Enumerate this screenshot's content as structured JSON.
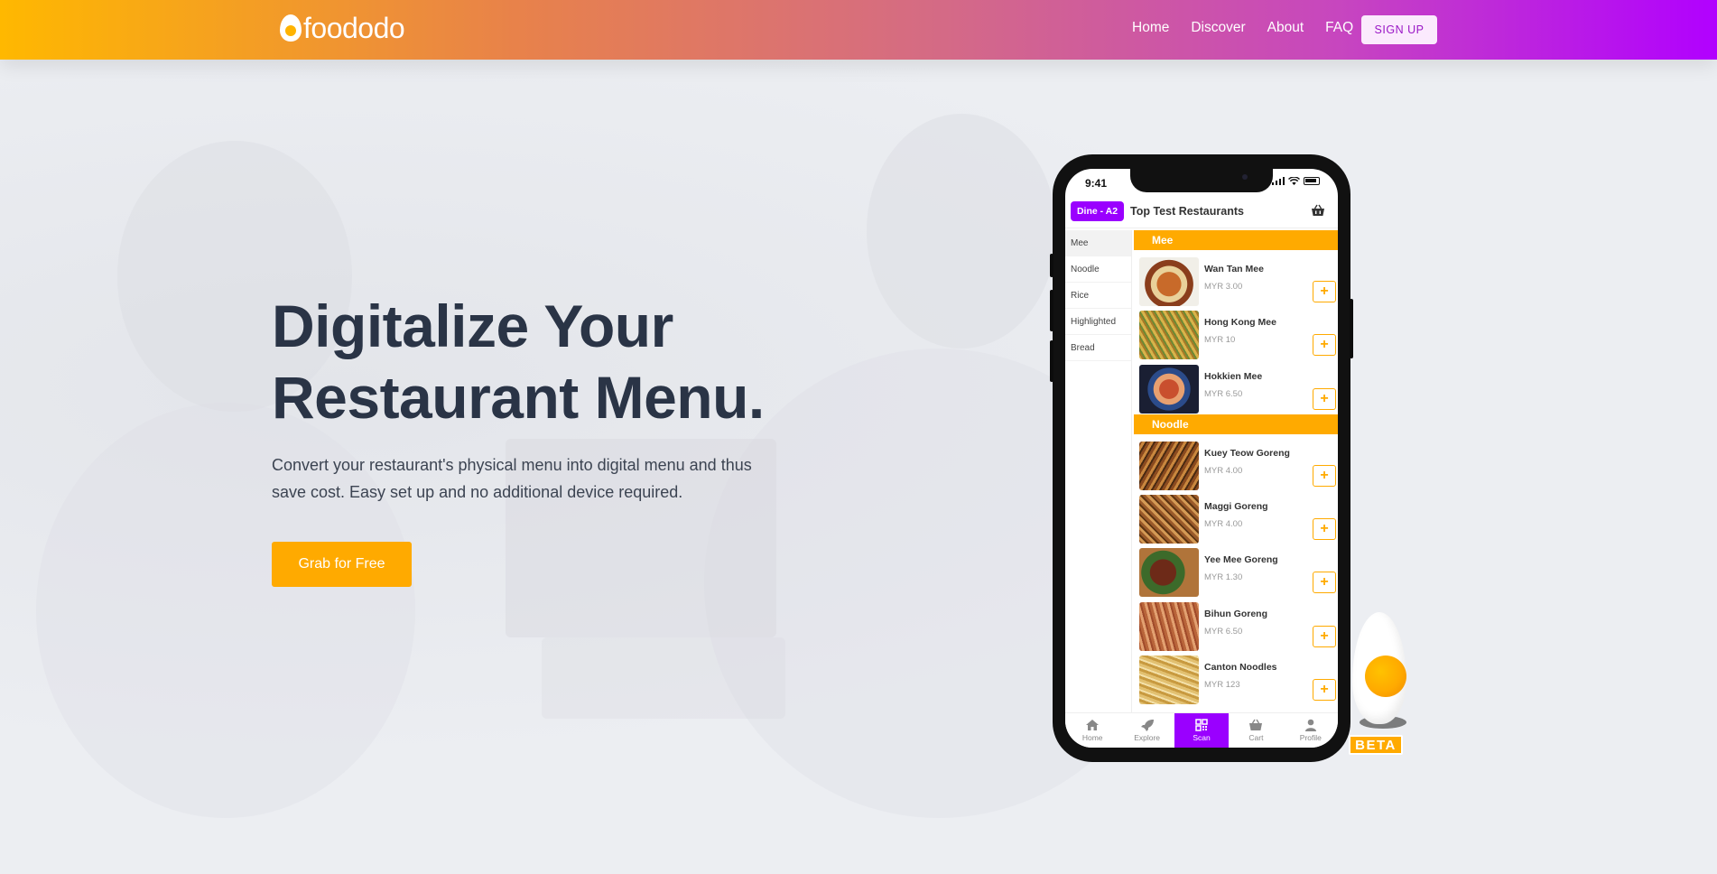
{
  "header": {
    "logo_text": "foododo",
    "nav": [
      "Home",
      "Discover",
      "About",
      "FAQ"
    ],
    "signup_label": "SIGN UP"
  },
  "hero": {
    "headline_line1": "Digitalize Your",
    "headline_line2": "Restaurant Menu.",
    "subtext": "Convert your restaurant's physical menu into digital menu and thus save cost. Easy set up and no additional device required.",
    "cta_label": "Grab for Free"
  },
  "phone": {
    "time": "9:41",
    "table_badge": "Dine - A2",
    "restaurant_name": "Top Test Restaurants",
    "categories": [
      "Mee",
      "Noodle",
      "Rice",
      "Highlighted",
      "Bread"
    ],
    "active_category": "Mee",
    "sections": [
      {
        "title": "Mee",
        "items": [
          {
            "name": "Wan Tan Mee",
            "price": "MYR 3.00"
          },
          {
            "name": "Hong Kong Mee",
            "price": "MYR 10"
          },
          {
            "name": "Hokkien Mee",
            "price": "MYR 6.50"
          }
        ]
      },
      {
        "title": "Noodle",
        "items": [
          {
            "name": "Kuey Teow Goreng",
            "price": "MYR 4.00"
          },
          {
            "name": "Maggi Goreng",
            "price": "MYR 4.00"
          },
          {
            "name": "Yee Mee Goreng",
            "price": "MYR 1.30"
          },
          {
            "name": "Bihun Goreng",
            "price": "MYR 6.50"
          },
          {
            "name": "Canton Noodles",
            "price": "MYR 123"
          }
        ]
      }
    ],
    "add_symbol": "+",
    "tabs": [
      "Home",
      "Explore",
      "Scan",
      "Cart",
      "Profile"
    ],
    "active_tab": "Scan"
  },
  "badge": {
    "label": "BETA"
  },
  "colors": {
    "accent_orange": "#ffaa00",
    "accent_purple": "#9a00ff",
    "headline": "#2a3446"
  }
}
